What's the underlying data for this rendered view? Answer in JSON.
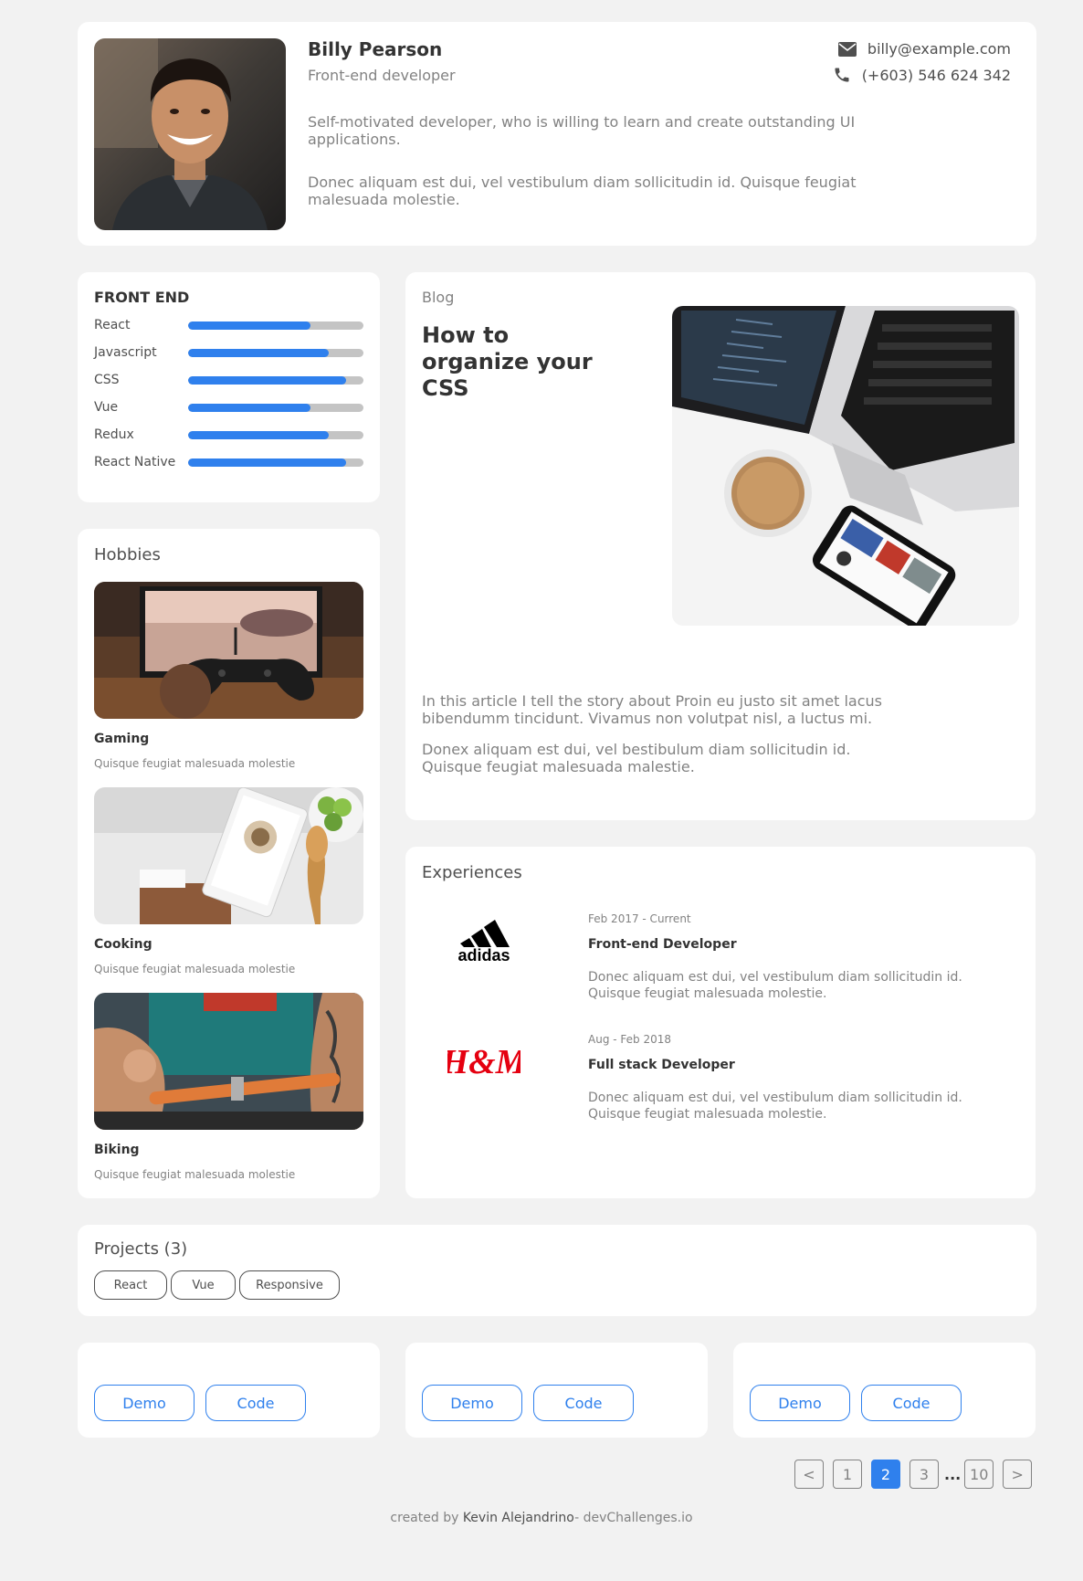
{
  "profile": {
    "name": "Billy Pearson",
    "role": "Front-end developer",
    "bio": "Self-motivated developer, who is willing to learn and create outstanding UI applications.",
    "bio2": "Donec aliquam est dui, vel vestibulum diam sollicitudin id. Quisque feugiat malesuada molestie.",
    "email": "billy@example.com",
    "phone": "(+603) 546 624 342"
  },
  "skills": {
    "title": "FRONT END",
    "items": [
      {
        "name": "React",
        "level": 0.7
      },
      {
        "name": "Javascript",
        "level": 0.8
      },
      {
        "name": "CSS",
        "level": 0.9
      },
      {
        "name": "Vue",
        "level": 0.7
      },
      {
        "name": "Redux",
        "level": 0.8
      },
      {
        "name": "React Native",
        "level": 0.9
      }
    ]
  },
  "hobbies": {
    "title": "Hobbies",
    "items": [
      {
        "title": "Gaming",
        "desc": "Quisque feugiat malesuada molestie"
      },
      {
        "title": "Cooking",
        "desc": "Quisque feugiat malesuada molestie"
      },
      {
        "title": "Biking",
        "desc": "Quisque feugiat malesuada molestie"
      }
    ]
  },
  "blog": {
    "label": "Blog",
    "title": "How to organize your CSS",
    "p1": "In this article I tell the story about Proin eu justo sit amet lacus bibendumm tincidunt. Vivamus non volutpat nisl, a luctus mi.",
    "p2": "Donex aliquam est dui, vel bestibulum diam sollicitudin id. Quisque feugiat malesuada malestie."
  },
  "experiences": {
    "title": "Experiences",
    "items": [
      {
        "date": "Feb 2017 - Current",
        "role": "Front-end Developer",
        "desc": "Donec aliquam est dui, vel vestibulum diam sollicitudin id. Quisque feugiat malesuada molestie.",
        "logo_text": "adidas"
      },
      {
        "date": "Aug - Feb 2018",
        "role": "Full stack Developer",
        "desc": "Donec aliquam est dui, vel vestibulum diam sollicitudin id. Quisque feugiat malesuada molestie.",
        "logo_text": "H&M"
      }
    ]
  },
  "projects": {
    "title": "Projects (3)",
    "tags": [
      "React",
      "Vue",
      "Responsive"
    ],
    "cards": [
      {
        "demo": "Demo",
        "code": "Code"
      },
      {
        "demo": "Demo",
        "code": "Code"
      },
      {
        "demo": "Demo",
        "code": "Code"
      }
    ]
  },
  "pagination": {
    "prev": "<",
    "pages": [
      "1",
      "2",
      "3"
    ],
    "dots": "...",
    "last": "10",
    "next": ">",
    "current": "2"
  },
  "footer": {
    "prefix": "created by ",
    "author": "Kevin Alejandrino",
    "suffix": "- devChallenges.io"
  },
  "colors": {
    "accent": "#2f80ed",
    "background": "#f2f2f2",
    "card": "#ffffff",
    "muted_text": "#828282",
    "bar_track": "#c4c4c4",
    "hm_red": "#e50010"
  },
  "icons": {
    "email": "envelope-icon",
    "phone": "phone-icon"
  }
}
